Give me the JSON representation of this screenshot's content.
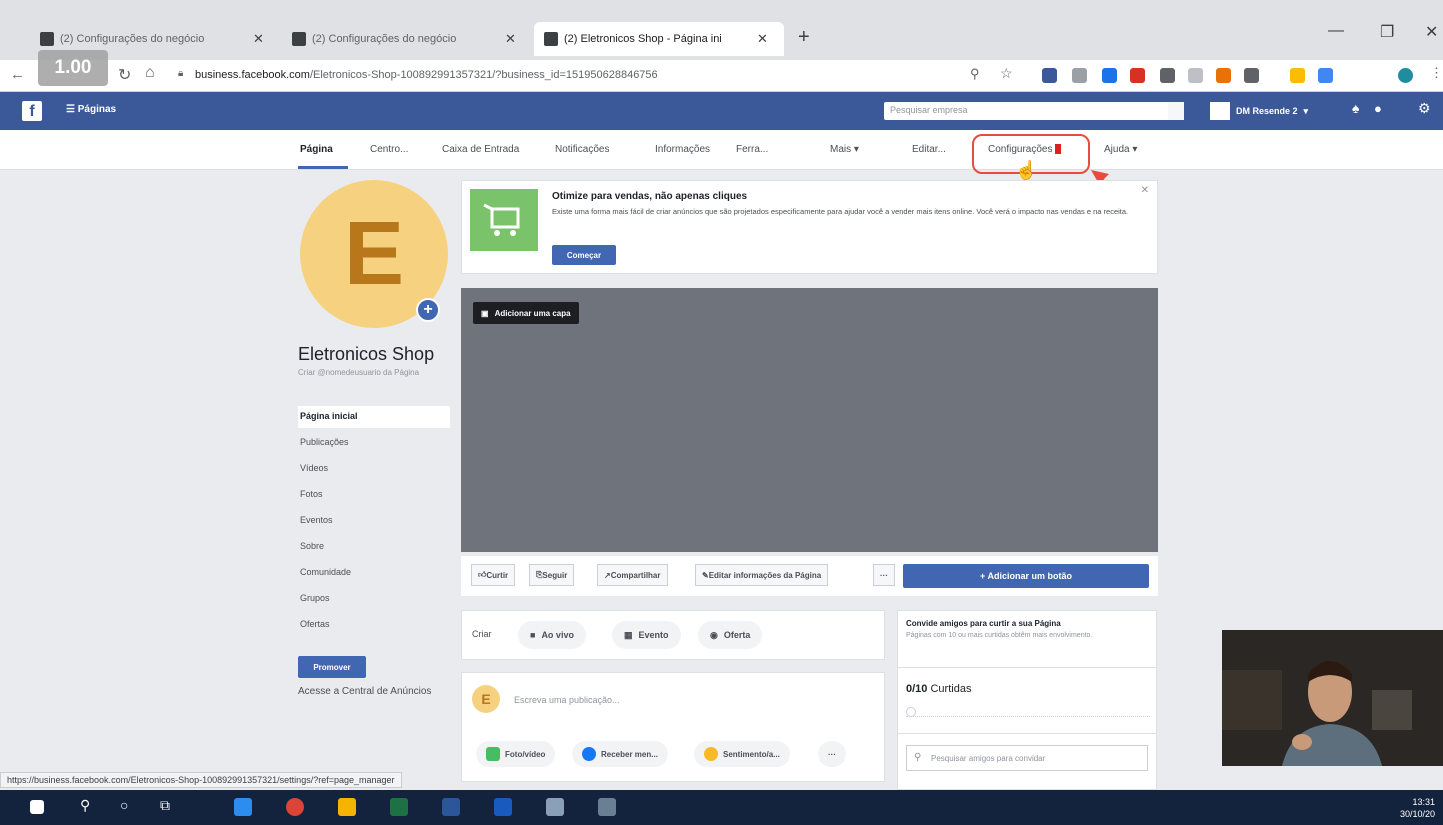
{
  "browser": {
    "tabs": [
      {
        "title": "(2) Configurações do negócio",
        "active": false
      },
      {
        "title": "(2) Configurações do negócio",
        "active": false
      },
      {
        "title": "(2) Eletronicos Shop - Página ini",
        "active": true
      }
    ],
    "new_tab": "+",
    "speed_overlay": "1.00",
    "url_domain": "business.facebook.com",
    "url_path": "/Eletronicos-Shop-100892991357321/?business_id=151950628846756",
    "status_url": "https://business.facebook.com/Eletronicos-Shop-100892991357321/settings/?ref=page_manager"
  },
  "fbnav": {
    "logo": "f",
    "pages_label": "Páginas",
    "search_placeholder": "Pesquisar empresa",
    "account_name": "DM Resende 2"
  },
  "page_tabs": [
    {
      "label": "Página",
      "selected": true
    },
    {
      "label": "Centro..."
    },
    {
      "label": "Caixa de Entrada"
    },
    {
      "label": "Notificações"
    },
    {
      "label": "Informações"
    },
    {
      "label": "Ferra..."
    },
    {
      "label": "Mais ▾"
    },
    {
      "label": "Editar..."
    },
    {
      "label": "Configurações"
    },
    {
      "label": "Ajuda ▾"
    }
  ],
  "profile": {
    "initial": "E",
    "name": "Eletronicos Shop",
    "username_hint": "Criar @nomedeusuario da Página"
  },
  "left_nav": [
    "Página inicial",
    "Publicações",
    "Vídeos",
    "Fotos",
    "Eventos",
    "Sobre",
    "Comunidade",
    "Grupos",
    "Ofertas"
  ],
  "promote_label": "Promover",
  "ads_center_label": "Acesse a Central de Anúncios",
  "optimize": {
    "title": "Otimize para vendas, não apenas cliques",
    "body": "Existe uma forma mais fácil de criar anúncios que são projetados especificamente para ajudar você a vender mais itens online. Você verá o impacto nas vendas e na receita.",
    "button": "Começar"
  },
  "cover": {
    "add_label": "Adicionar uma capa"
  },
  "actions": {
    "like": "Curtir",
    "follow": "Seguir",
    "share": "Compartilhar",
    "edit_info": "Editar informações da Página",
    "more": "···",
    "add_button": "+ Adicionar um botão"
  },
  "create": {
    "label": "Criar",
    "live": "Ao vivo",
    "event": "Evento",
    "offer": "Oferta"
  },
  "write": {
    "placeholder": "Escreva uma publicação...",
    "photo_video": "Foto/vídeo",
    "get_messages": "Receber men...",
    "feeling": "Sentimento/a...",
    "more": "···"
  },
  "invite": {
    "title": "Convide amigos para curtir a sua Página",
    "subtitle": "Páginas com 10 ou mais curtidas obtêm mais envolvimento.",
    "count": "0/10",
    "count_label": "Curtidas",
    "search_placeholder": "Pesquisar amigos para convidar"
  },
  "taskbar": {
    "time": "13:31",
    "date": "30/10/20"
  },
  "colors": {
    "fb_blue": "#3b5998",
    "button_blue": "#4267b2",
    "highlight_red": "#e74c3c",
    "avatar_yellow": "#f6d280"
  }
}
